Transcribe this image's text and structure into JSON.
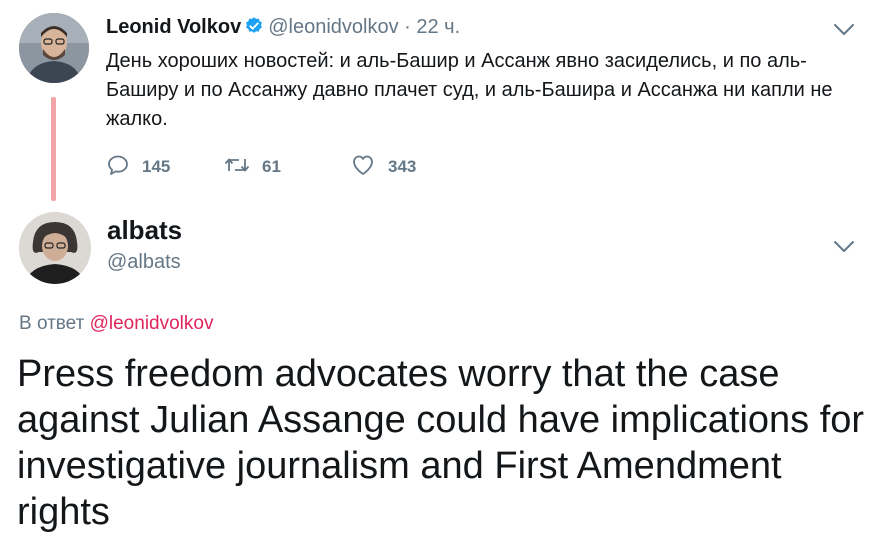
{
  "parent_tweet": {
    "name": "Leonid Volkov",
    "handle": "@leonidvolkov",
    "separator": "·",
    "time": "22 ч.",
    "text": "День хороших новостей: и аль-Башир и Ассанж явно засиделись, и по аль-Баширу и по Ассанжу давно плачет суд, и аль-Башира и Ассанжа ни капли не жалко.",
    "replies": "145",
    "retweets": "61",
    "likes": "343"
  },
  "reply_tweet": {
    "name": "albats",
    "handle": "@albats",
    "reply_prefix": "В ответ",
    "reply_mention": "@leonidvolkov",
    "text": "Press freedom advocates worry that the case against Julian Assange could have implications for investigative journalism and First Amendment rights"
  },
  "colors": {
    "text": "#14171a",
    "secondary": "#657786",
    "verified": "#1da1f2",
    "mention": "#e0245e",
    "thread_line": "#f2a5a8"
  },
  "icons": [
    "verified-badge-icon",
    "chevron-down-icon",
    "reply-icon",
    "retweet-icon",
    "like-icon"
  ]
}
